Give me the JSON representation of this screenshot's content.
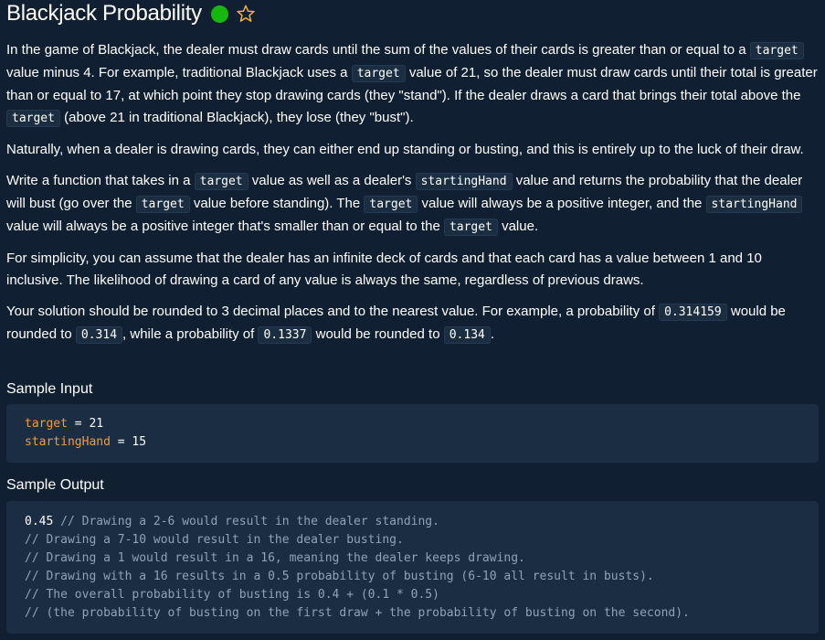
{
  "title": "Blackjack Probability",
  "status_color": "#17b80d",
  "star_icon": "star-outline",
  "paragraphs": {
    "p1": {
      "a": "In the game of Blackjack, the dealer must draw cards until the sum of the values of their cards is greater than or equal to a ",
      "c1": "target",
      "b": " value minus 4. For example, traditional Blackjack uses a ",
      "c2": "target",
      "c": " value of 21, so the dealer must draw cards until their total is greater than or equal to 17, at which point they stop drawing cards (they \"stand\"). If the dealer draws a card that brings their total above the ",
      "c3": "target",
      "d": " (above 21 in traditional Blackjack), they lose (they \"bust\")."
    },
    "p2": "Naturally, when a dealer is drawing cards, they can either end up standing or busting, and this is entirely up to the luck of their draw.",
    "p3": {
      "a": "Write a function that takes in a ",
      "c1": "target",
      "b": " value as well as a dealer's ",
      "c2": "startingHand",
      "c": " value and returns the probability that the dealer will bust (go over the ",
      "c3": "target",
      "d": " value before standing). The ",
      "c4": "target",
      "e": " value will always be a positive integer, and the ",
      "c5": "startingHand",
      "f": " value will always be a positive integer that's smaller than or equal to the ",
      "c6": "target",
      "g": " value."
    },
    "p4": "For simplicity, you can assume that the dealer has an infinite deck of cards and that each card has a value between 1 and 10 inclusive. The likelihood of drawing a card of any value is always the same, regardless of previous draws.",
    "p5": {
      "a": "Your solution should be rounded to 3 decimal places and to the nearest value. For example, a probability of ",
      "c1": "0.314159",
      "b": " would be rounded to ",
      "c2": "0.314",
      "c": ", while a probability of ",
      "c3": "0.1337",
      "d": " would be rounded to ",
      "c4": "0.134",
      "e": "."
    }
  },
  "sample_input": {
    "heading": "Sample Input",
    "line1_name": "target",
    "line1_rest": " = 21",
    "line2_name": "startingHand",
    "line2_rest": " = 15"
  },
  "sample_output": {
    "heading": "Sample Output",
    "value": "0.45",
    "comments": [
      " // Drawing a 2-6 would result in the dealer standing.",
      "// Drawing a 7-10 would result in the dealer busting.",
      "// Drawing a 1 would result in a 16, meaning the dealer keeps drawing.",
      "// Drawing with a 16 results in a 0.5 probability of busting (6-10 all result in busts).",
      "// The overall probability of busting is 0.4 + (0.1 * 0.5)",
      "// (the probability of busting on the first draw + the probability of busting on the second)."
    ]
  }
}
